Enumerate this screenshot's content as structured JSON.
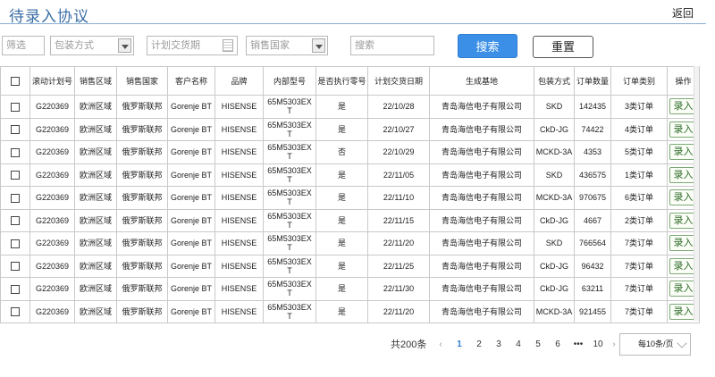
{
  "header": {
    "title": "待录入协议",
    "back_label": "返回"
  },
  "filters": {
    "filter_placeholder": "筛选",
    "packaging_placeholder": "包装方式",
    "delivery_date_placeholder": "计划交货期",
    "sales_country_placeholder": "销售国家",
    "search_placeholder": "搜索",
    "search_button": "搜索",
    "reset_button": "重置"
  },
  "table": {
    "columns": [
      "滚动计划号",
      "销售区域",
      "销售国家",
      "客户名称",
      "品牌",
      "内部型号",
      "是否执行零号",
      "计划交货日期",
      "生成基地",
      "包装方式",
      "订单数量",
      "订单类别",
      "操作"
    ],
    "rows": [
      {
        "plan": "G220369",
        "region": "欧洲区域",
        "country": "俄罗斯联邦",
        "customer": "Gorenje BT",
        "brand": "HISENSE",
        "model_line1": "65M5303EX",
        "model_line2": "T",
        "zero": "是",
        "date": "22/10/28",
        "base": "青岛海信电子有限公司",
        "pack": "SKD",
        "qty": "142435",
        "type": "3类订单",
        "action": "录入"
      },
      {
        "plan": "G220369",
        "region": "欧洲区域",
        "country": "俄罗斯联邦",
        "customer": "Gorenje BT",
        "brand": "HISENSE",
        "model_line1": "65M5303EX",
        "model_line2": "T",
        "zero": "是",
        "date": "22/10/27",
        "base": "青岛海信电子有限公司",
        "pack": "CkD-JG",
        "qty": "74422",
        "type": "4类订单",
        "action": "录入"
      },
      {
        "plan": "G220369",
        "region": "欧洲区域",
        "country": "俄罗斯联邦",
        "customer": "Gorenje BT",
        "brand": "HISENSE",
        "model_line1": "65M5303EX",
        "model_line2": "T",
        "zero": "否",
        "date": "22/10/29",
        "base": "青岛海信电子有限公司",
        "pack": "MCKD-3A",
        "qty": "4353",
        "type": "5类订单",
        "action": "录入"
      },
      {
        "plan": "G220369",
        "region": "欧洲区域",
        "country": "俄罗斯联邦",
        "customer": "Gorenje BT",
        "brand": "HISENSE",
        "model_line1": "65M5303EX",
        "model_line2": "T",
        "zero": "是",
        "date": "22/11/05",
        "base": "青岛海信电子有限公司",
        "pack": "SKD",
        "qty": "436575",
        "type": "1类订单",
        "action": "录入"
      },
      {
        "plan": "G220369",
        "region": "欧洲区域",
        "country": "俄罗斯联邦",
        "customer": "Gorenje BT",
        "brand": "HISENSE",
        "model_line1": "65M5303EX",
        "model_line2": "T",
        "zero": "是",
        "date": "22/11/10",
        "base": "青岛海信电子有限公司",
        "pack": "MCKD-3A",
        "qty": "970675",
        "type": "6类订单",
        "action": "录入"
      },
      {
        "plan": "G220369",
        "region": "欧洲区域",
        "country": "俄罗斯联邦",
        "customer": "Gorenje BT",
        "brand": "HISENSE",
        "model_line1": "65M5303EX",
        "model_line2": "T",
        "zero": "是",
        "date": "22/11/15",
        "base": "青岛海信电子有限公司",
        "pack": "CkD-JG",
        "qty": "4667",
        "type": "2类订单",
        "action": "录入"
      },
      {
        "plan": "G220369",
        "region": "欧洲区域",
        "country": "俄罗斯联邦",
        "customer": "Gorenje BT",
        "brand": "HISENSE",
        "model_line1": "65M5303EX",
        "model_line2": "T",
        "zero": "是",
        "date": "22/11/20",
        "base": "青岛海信电子有限公司",
        "pack": "SKD",
        "qty": "766564",
        "type": "7类订单",
        "action": "录入"
      },
      {
        "plan": "G220369",
        "region": "欧洲区域",
        "country": "俄罗斯联邦",
        "customer": "Gorenje BT",
        "brand": "HISENSE",
        "model_line1": "65M5303EX",
        "model_line2": "T",
        "zero": "是",
        "date": "22/11/25",
        "base": "青岛海信电子有限公司",
        "pack": "CkD-JG",
        "qty": "96432",
        "type": "7类订单",
        "action": "录入"
      },
      {
        "plan": "G220369",
        "region": "欧洲区域",
        "country": "俄罗斯联邦",
        "customer": "Gorenje BT",
        "brand": "HISENSE",
        "model_line1": "65M5303EX",
        "model_line2": "T",
        "zero": "是",
        "date": "22/11/30",
        "base": "青岛海信电子有限公司",
        "pack": "CkD-JG",
        "qty": "63211",
        "type": "7类订单",
        "action": "录入"
      },
      {
        "plan": "G220369",
        "region": "欧洲区域",
        "country": "俄罗斯联邦",
        "customer": "Gorenje BT",
        "brand": "HISENSE",
        "model_line1": "65M5303EX",
        "model_line2": "T",
        "zero": "是",
        "date": "22/11/20",
        "base": "青岛海信电子有限公司",
        "pack": "MCKD-3A",
        "qty": "921455",
        "type": "7类订单",
        "action": "录入"
      }
    ]
  },
  "pagination": {
    "total": "共200条",
    "prev": "‹",
    "pages": [
      "1",
      "2",
      "3",
      "4",
      "5",
      "6",
      "•••",
      "10"
    ],
    "next": "›",
    "page_size": "每10条/页"
  }
}
